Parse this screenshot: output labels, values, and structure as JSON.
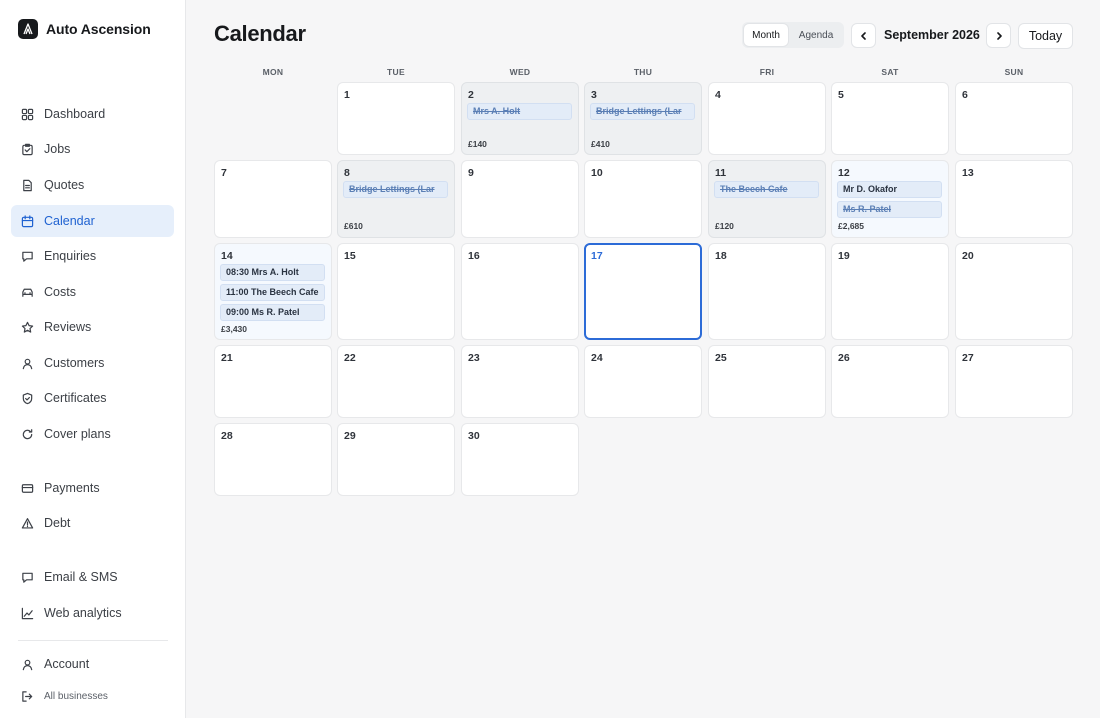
{
  "brand": {
    "name": "Auto Ascension"
  },
  "nav": {
    "dashboard": "Dashboard",
    "jobs": "Jobs",
    "quotes": "Quotes",
    "calendar": "Calendar",
    "enquiries": "Enquiries",
    "costs": "Costs",
    "reviews": "Reviews",
    "customers": "Customers",
    "certificates": "Certificates",
    "cover_plans": "Cover plans",
    "payments": "Payments",
    "debt": "Debt",
    "email_sms": "Email & SMS",
    "web_analytics": "Web analytics",
    "account": "Account",
    "all_businesses": "All businesses"
  },
  "header": {
    "title": "Calendar",
    "view_month": "Month",
    "view_agenda": "Agenda",
    "active_view": "Month",
    "month_label": "September 2026",
    "today": "Today"
  },
  "weekdays": [
    "MON",
    "TUE",
    "WED",
    "THU",
    "FRI",
    "SAT",
    "SUN"
  ],
  "days": {
    "d1": {
      "num": "1"
    },
    "d2": {
      "num": "2",
      "events": [
        "Mrs A. Holt"
      ],
      "total": "£140"
    },
    "d3": {
      "num": "3",
      "events": [
        "Bridge Lettings (Lar"
      ],
      "total": "£410"
    },
    "d4": {
      "num": "4"
    },
    "d5": {
      "num": "5"
    },
    "d6": {
      "num": "6"
    },
    "d7": {
      "num": "7"
    },
    "d8": {
      "num": "8",
      "events": [
        "Bridge Lettings (Lar"
      ],
      "total": "£610"
    },
    "d9": {
      "num": "9"
    },
    "d10": {
      "num": "10"
    },
    "d11": {
      "num": "11",
      "events": [
        "The Beech Cafe"
      ],
      "total": "£120"
    },
    "d12": {
      "num": "12",
      "events": [
        "Mr D. Okafor",
        "Ms R. Patel"
      ],
      "total": "£2,685"
    },
    "d13": {
      "num": "13"
    },
    "d14": {
      "num": "14",
      "events": [
        "08:30 Mrs A. Holt",
        "11:00 The Beech Cafe",
        "09:00 Ms R. Patel"
      ],
      "total": "£3,430"
    },
    "d15": {
      "num": "15"
    },
    "d16": {
      "num": "16"
    },
    "d17": {
      "num": "17"
    },
    "d18": {
      "num": "18"
    },
    "d19": {
      "num": "19"
    },
    "d20": {
      "num": "20"
    },
    "d21": {
      "num": "21"
    },
    "d22": {
      "num": "22"
    },
    "d23": {
      "num": "23"
    },
    "d24": {
      "num": "24"
    },
    "d25": {
      "num": "25"
    },
    "d26": {
      "num": "26"
    },
    "d27": {
      "num": "27"
    },
    "d28": {
      "num": "28"
    },
    "d29": {
      "num": "29"
    },
    "d30": {
      "num": "30"
    }
  },
  "colors": {
    "accent": "#2c6bd7",
    "active_nav_bg": "#e6effb",
    "event_bg": "#e3ecf8",
    "past_day_bg": "#eef0f2"
  },
  "icons": {
    "brand": "brand-logo-icon",
    "dashboard": "grid-icon",
    "jobs": "clipboard-icon",
    "quotes": "document-icon",
    "calendar": "calendar-icon",
    "enquiries": "chat-icon",
    "costs": "car-icon",
    "reviews": "star-icon",
    "customers": "user-icon",
    "certificates": "shield-icon",
    "cover_plans": "refresh-icon",
    "payments": "card-icon",
    "debt": "warning-icon",
    "email_sms": "message-icon",
    "web_analytics": "chart-icon",
    "account": "account-icon",
    "all_businesses": "logout-icon"
  }
}
